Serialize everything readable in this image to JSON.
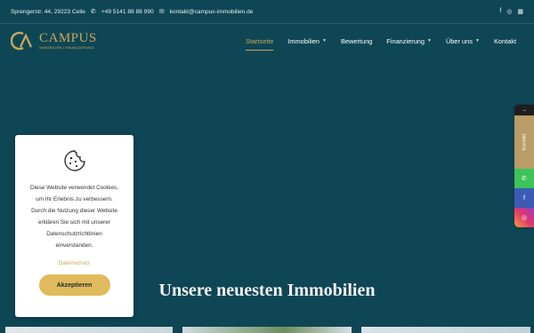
{
  "topbar": {
    "address": "Sprengerstr. 44, 29223 Celle",
    "phone": "+49 5141 88 88 990",
    "email": "kontakt@campus-immobilien.de",
    "social": [
      "facebook-icon",
      "instagram-icon",
      "map-icon"
    ]
  },
  "logo": {
    "name": "CAMPUS",
    "tagline": "IMMOBILIEN | FINANZIERUNG"
  },
  "nav": {
    "items": [
      {
        "label": "Startseite",
        "active": true,
        "dropdown": false
      },
      {
        "label": "Immobilien",
        "active": false,
        "dropdown": true
      },
      {
        "label": "Bewertung",
        "active": false,
        "dropdown": false
      },
      {
        "label": "Finanzierung",
        "active": false,
        "dropdown": true
      },
      {
        "label": "Über uns",
        "active": false,
        "dropdown": true
      },
      {
        "label": "Kontakt",
        "active": false,
        "dropdown": false
      }
    ]
  },
  "side": {
    "kontakt_label": "Kontakt"
  },
  "cookie": {
    "text": "Diese Website verwendet Cookies, um Ihr Erlebnis zu verbessern. Durch die Nutzung dieser Website erklären Sie sich mit unserer Datenschutzrichtlinien einverstanden.",
    "link": "Datenschutz",
    "button": "Akzeptieren"
  },
  "main": {
    "heading": "Unsere neuesten Immobilien"
  },
  "colors": {
    "background": "#0f4655",
    "accent": "#c9a858",
    "button": "#e0ba5c"
  }
}
